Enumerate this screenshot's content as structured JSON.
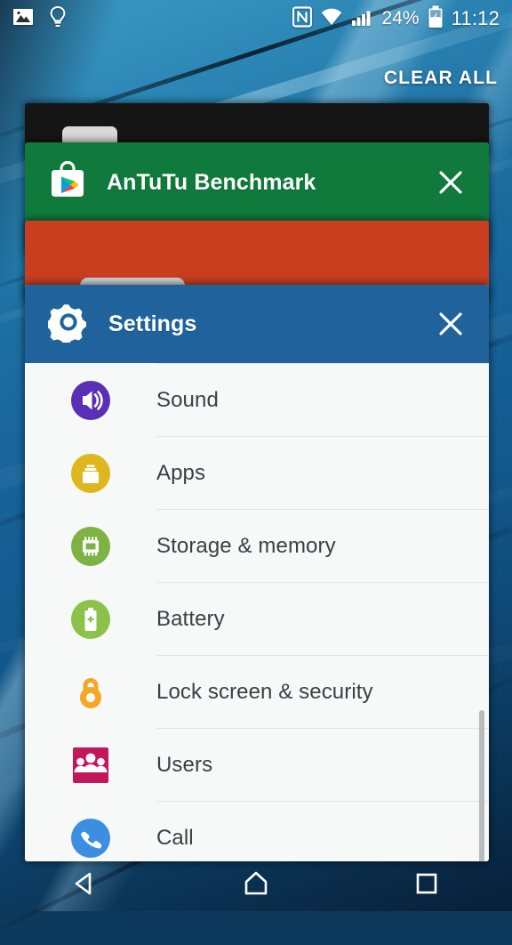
{
  "status_bar": {
    "left_icons": [
      {
        "name": "photo-icon",
        "glyph": "image"
      },
      {
        "name": "lightbulb-icon",
        "glyph": "bulb"
      }
    ],
    "right_icons": [
      {
        "name": "nfc-icon",
        "glyph": "N"
      },
      {
        "name": "wifi-icon",
        "glyph": "wifi"
      },
      {
        "name": "cellular-signal-icon",
        "glyph": "bars"
      }
    ],
    "battery_percent": "24%",
    "battery_state": "charging",
    "time": "11:12"
  },
  "recents": {
    "clear_all_label": "CLEAR ALL",
    "cards": [
      {
        "app_title": "AnTuTu Benchmark",
        "icon_name": "play-store-icon",
        "header_color": "#0f7a3c",
        "close_label": "×"
      },
      {
        "app_title": "Settings",
        "icon_name": "gear-icon",
        "header_color": "#20639c",
        "close_label": "×"
      }
    ],
    "partial_card_colors": [
      "#151515",
      "#c83e1f"
    ]
  },
  "settings_preview": {
    "items": [
      {
        "label": "Sound",
        "icon_name": "volume-icon",
        "icon_color": "#5b2fb5"
      },
      {
        "label": "Apps",
        "icon_name": "apps-box-icon",
        "icon_color": "#e0b61e"
      },
      {
        "label": "Storage & memory",
        "icon_name": "chip-icon",
        "icon_color": "#7cb342"
      },
      {
        "label": "Battery",
        "icon_name": "battery-icon",
        "icon_color": "#8bc34a"
      },
      {
        "label": "Lock screen & security",
        "icon_name": "lock-icon",
        "icon_color": "#f5a623"
      },
      {
        "label": "Users",
        "icon_name": "users-icon",
        "icon_color": "#c2185b"
      },
      {
        "label": "Call",
        "icon_name": "phone-icon",
        "icon_color": "#3b8ee0"
      }
    ]
  },
  "nav_bar": {
    "buttons": [
      {
        "name": "back-button",
        "glyph": "triangle-left"
      },
      {
        "name": "home-button",
        "glyph": "house"
      },
      {
        "name": "recents-button",
        "glyph": "square"
      }
    ]
  },
  "colors": {
    "wallpaper_top": "#3d9ac4",
    "wallpaper_bottom": "#081f38",
    "card_green": "#0f7a3c",
    "card_orange": "#c83e1f",
    "card_blue": "#20639c",
    "list_background": "#f7f8f8",
    "list_text": "#3c4043"
  }
}
